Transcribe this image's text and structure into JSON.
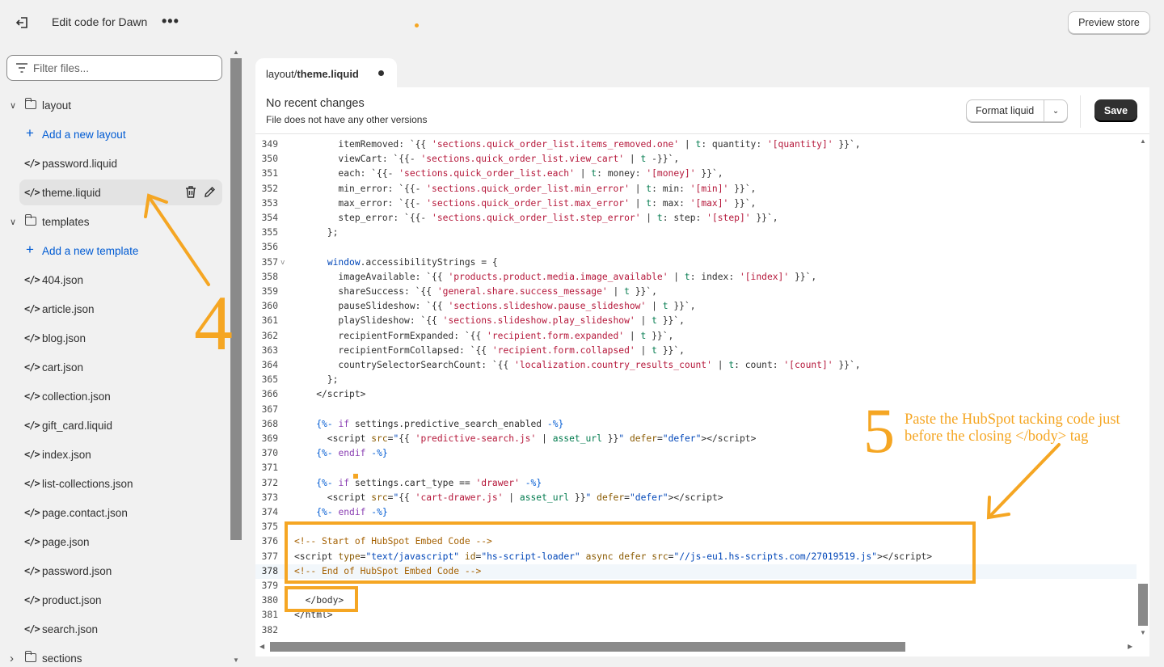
{
  "topbar": {
    "title": "Edit code for Dawn",
    "more": "•••",
    "preview_label": "Preview store"
  },
  "sidebar": {
    "filter_placeholder": "Filter files...",
    "items": [
      {
        "kind": "folder",
        "label": "layout",
        "expanded": true
      },
      {
        "kind": "add",
        "label": "Add a new layout"
      },
      {
        "kind": "file",
        "label": "password.liquid"
      },
      {
        "kind": "file",
        "label": "theme.liquid",
        "selected": true
      },
      {
        "kind": "folder",
        "label": "templates",
        "expanded": true
      },
      {
        "kind": "add",
        "label": "Add a new template"
      },
      {
        "kind": "file",
        "label": "404.json"
      },
      {
        "kind": "file",
        "label": "article.json"
      },
      {
        "kind": "file",
        "label": "blog.json"
      },
      {
        "kind": "file",
        "label": "cart.json"
      },
      {
        "kind": "file",
        "label": "collection.json"
      },
      {
        "kind": "file",
        "label": "gift_card.liquid"
      },
      {
        "kind": "file",
        "label": "index.json"
      },
      {
        "kind": "file",
        "label": "list-collections.json"
      },
      {
        "kind": "file",
        "label": "page.contact.json"
      },
      {
        "kind": "file",
        "label": "page.json"
      },
      {
        "kind": "file",
        "label": "password.json"
      },
      {
        "kind": "file",
        "label": "product.json"
      },
      {
        "kind": "file",
        "label": "search.json"
      },
      {
        "kind": "folder",
        "label": "sections",
        "expanded": false
      }
    ]
  },
  "tab": {
    "path": "layout/",
    "filename": "theme.liquid"
  },
  "editor_header": {
    "title": "No recent changes",
    "subtitle": "File does not have any other versions",
    "format_label": "Format liquid",
    "save_label": "Save"
  },
  "code_lines": [
    {
      "n": "349",
      "html": "        itemRemoved: `{{ <span class='s'>'sections.quick_order_list.items_removed.one'</span> | <span class='g'>t</span>: quantity: <span class='s'>'[quantity]'</span> }}`,"
    },
    {
      "n": "350",
      "html": "        viewCart: `{{- <span class='s'>'sections.quick_order_list.view_cart'</span> | <span class='g'>t</span> -}}`,"
    },
    {
      "n": "351",
      "html": "        each: `{{- <span class='s'>'sections.quick_order_list.each'</span> | <span class='g'>t</span>: money: <span class='s'>'[money]'</span> }}`,"
    },
    {
      "n": "352",
      "html": "        min_error: `{{- <span class='s'>'sections.quick_order_list.min_error'</span> | <span class='g'>t</span>: min: <span class='s'>'[min]'</span> }}`,"
    },
    {
      "n": "353",
      "html": "        max_error: `{{- <span class='s'>'sections.quick_order_list.max_error'</span> | <span class='g'>t</span>: max: <span class='s'>'[max]'</span> }}`,"
    },
    {
      "n": "354",
      "html": "        step_error: `{{- <span class='s'>'sections.quick_order_list.step_error'</span> | <span class='g'>t</span>: step: <span class='s'>'[step]'</span> }}`,"
    },
    {
      "n": "355",
      "html": "      };"
    },
    {
      "n": "356",
      "html": ""
    },
    {
      "n": "357",
      "fold": "v",
      "html": "      <span class='av'>window</span>.accessibilityStrings = {"
    },
    {
      "n": "358",
      "html": "        imageAvailable: `{{ <span class='s'>'products.product.media.image_available'</span> | <span class='g'>t</span>: index: <span class='s'>'[index]'</span> }}`,"
    },
    {
      "n": "359",
      "html": "        shareSuccess: `{{ <span class='s'>'general.share.success_message'</span> | <span class='g'>t</span> }}`,"
    },
    {
      "n": "360",
      "html": "        pauseSlideshow: `{{ <span class='s'>'sections.slideshow.pause_slideshow'</span> | <span class='g'>t</span> }}`,"
    },
    {
      "n": "361",
      "html": "        playSlideshow: `{{ <span class='s'>'sections.slideshow.play_slideshow'</span> | <span class='g'>t</span> }}`,"
    },
    {
      "n": "362",
      "html": "        recipientFormExpanded: `{{ <span class='s'>'recipient.form.expanded'</span> | <span class='g'>t</span> }}`,"
    },
    {
      "n": "363",
      "html": "        recipientFormCollapsed: `{{ <span class='s'>'recipient.form.collapsed'</span> | <span class='g'>t</span> }}`,"
    },
    {
      "n": "364",
      "html": "        countrySelectorSearchCount: `{{ <span class='s'>'localization.country_results_count'</span> | <span class='g'>t</span>: count: <span class='s'>'[count]'</span> }}`,"
    },
    {
      "n": "365",
      "html": "      };"
    },
    {
      "n": "366",
      "html": "    &lt;/script&gt;"
    },
    {
      "n": "367",
      "html": ""
    },
    {
      "n": "368",
      "html": "    <span class='lq'>{%-</span> <span class='k'>if</span> settings.predictive_search_enabled <span class='lq'>-%}</span>"
    },
    {
      "n": "369",
      "html": "      &lt;script <span class='at'>src</span>=<span class='av'>\"</span>{{ <span class='s'>'predictive-search.js'</span> | <span class='g'>asset_url</span> }}<span class='av'>\"</span> <span class='at'>defer</span>=<span class='av'>\"defer\"</span>&gt;&lt;/script&gt;"
    },
    {
      "n": "370",
      "html": "    <span class='lq'>{%-</span> <span class='k'>endif</span> <span class='lq'>-%}</span>"
    },
    {
      "n": "371",
      "html": ""
    },
    {
      "n": "372",
      "html": "    <span class='lq'>{%-</span> <span class='k'>if</span> settings.cart_type == <span class='s'>'drawer'</span> <span class='lq'>-%}</span>"
    },
    {
      "n": "373",
      "html": "      &lt;script <span class='at'>src</span>=<span class='av'>\"</span>{{ <span class='s'>'cart-drawer.js'</span> | <span class='g'>asset_url</span> }}<span class='av'>\"</span> <span class='at'>defer</span>=<span class='av'>\"defer\"</span>&gt;&lt;/script&gt;"
    },
    {
      "n": "374",
      "html": "    <span class='lq'>{%-</span> <span class='k'>endif</span> <span class='lq'>-%}</span>"
    },
    {
      "n": "375",
      "html": ""
    },
    {
      "n": "376",
      "html": "<span class='c'>&lt;!-- Start of HubSpot Embed Code --&gt;</span>"
    },
    {
      "n": "377",
      "html": "&lt;script <span class='at'>type</span>=<span class='av'>\"text/javascript\"</span> <span class='at'>id</span>=<span class='av'>\"hs-script-loader\"</span> <span class='at'>async</span> <span class='at'>defer</span> <span class='at'>src</span>=<span class='av'>\"//js-eu1.hs-scripts.com/27019519.js\"</span>&gt;&lt;/script&gt;"
    },
    {
      "n": "378",
      "hl": true,
      "html": "<span class='c'>&lt;!-- End of HubSpot Embed Code --&gt;</span>"
    },
    {
      "n": "379",
      "html": ""
    },
    {
      "n": "380",
      "html": "  &lt;/body&gt;"
    },
    {
      "n": "381",
      "html": "&lt;/html&gt;"
    },
    {
      "n": "382",
      "html": ""
    }
  ],
  "annotations": {
    "step4": "4",
    "step5": "5",
    "note5_line1": "Paste the HubSpot tacking code just",
    "note5_line2": "before the closing </body> tag",
    "accent": "#f5a623"
  }
}
